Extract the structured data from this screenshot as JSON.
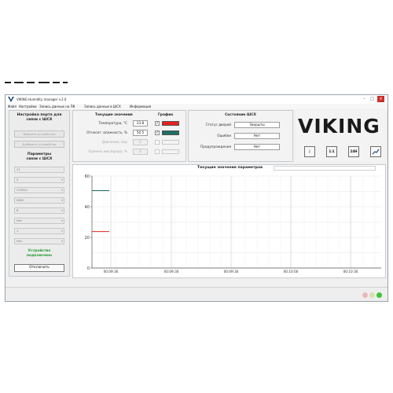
{
  "window": {
    "title": "VIKING Humidity manager v.2.0",
    "controls": {
      "minimize": "–",
      "maximize": "□",
      "close": "×"
    }
  },
  "menu": [
    "Файл",
    "Настройки",
    "Запись данных на ПК",
    "Запись данных в ШСХ",
    "Информация"
  ],
  "port_panel": {
    "title_line1": "Настройка порта для",
    "title_line2": "связи с ШСХ",
    "select_device": "Выбрать устройство",
    "add_device": "Добавить устройство",
    "params_line1": "Параметры",
    "params_line2": "связи с ШСХ",
    "fields": [
      "11",
      "5",
      "COM10",
      "9600",
      "8",
      "Нет",
      "1",
      "Нет"
    ],
    "status_line1": "Устройство",
    "status_line2": "подключено",
    "disconnect": "Отключить"
  },
  "values_panel": {
    "header_values": "Текущие значения",
    "header_chart": "График",
    "rows": [
      {
        "label": "Температура, °С",
        "value": "23.8",
        "checked": true,
        "enabled": true,
        "color": "#e8201f"
      },
      {
        "label": "Относит. влажность, %",
        "value": "50.5",
        "checked": true,
        "enabled": true,
        "color": "#1e6e63"
      },
      {
        "label": "Давление, бар",
        "value": "0",
        "checked": false,
        "enabled": false,
        "color": ""
      },
      {
        "label": "Уровень кислорода, %",
        "value": "0",
        "checked": false,
        "enabled": false,
        "color": ""
      }
    ],
    "check_mark": "✓"
  },
  "state_panel": {
    "header": "Состояние ШСХ",
    "rows": [
      {
        "label": "Статус дверей",
        "value": "Закрыты"
      },
      {
        "label": "Ошибки",
        "value": "Нет"
      },
      {
        "label": "Предупреждения",
        "value": "Нет"
      }
    ]
  },
  "brand": {
    "logo": "VIKING",
    "buttons": [
      {
        "name": "cursor-toggle-button",
        "label": "|"
      },
      {
        "name": "scale-1-1-button",
        "label": "1:1"
      },
      {
        "name": "range-24h-button",
        "label": "24H"
      },
      {
        "name": "chart-view-button",
        "label": ""
      }
    ]
  },
  "chart_data": {
    "type": "line",
    "title": "Текущие значения параметров",
    "ylim": [
      0,
      60
    ],
    "yticks": [
      0,
      20,
      40,
      60
    ],
    "xticks": [
      "00:09:30",
      "00:09:30",
      "00:09:30",
      "00:10:00",
      "00:10:30"
    ],
    "grid": true,
    "series": [
      {
        "values": [
          50.5,
          50.5
        ],
        "color": "#1e6e63"
      },
      {
        "values": [
          23.8,
          23.8
        ],
        "color": "#e8201f"
      }
    ]
  },
  "status_lamps": [
    {
      "name": "lamp-left",
      "color": "#e8b9b9"
    },
    {
      "name": "lamp-middle",
      "color": "#dcdcb0"
    },
    {
      "name": "lamp-right",
      "color": "#3cc43c"
    }
  ]
}
